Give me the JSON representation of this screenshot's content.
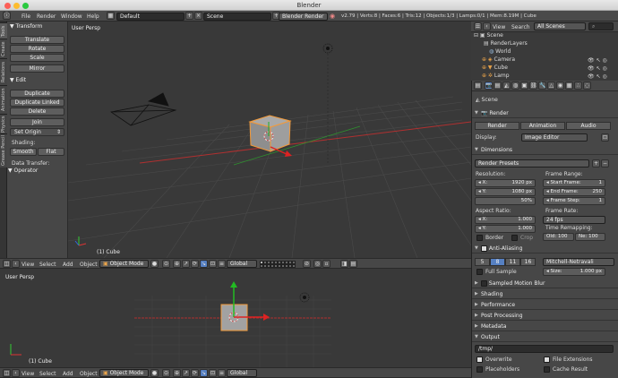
{
  "window": {
    "title": "Blender"
  },
  "info_bar": {
    "menus": [
      "File",
      "Render",
      "Window",
      "Help"
    ],
    "layout": "Default",
    "scene": "Scene",
    "engine": "Blender Render",
    "stats": "v2.79 | Verts:8 | Faces:6 | Tris:12 | Objects:1/3 | Lamps:0/1 | Mem:8.19M | Cube"
  },
  "left_tabs": [
    "Tools",
    "Create",
    "Relations",
    "Animation",
    "Physics",
    "Grease Pencil"
  ],
  "tool_shelf": {
    "transform_title": "Transform",
    "transform_buttons": [
      "Translate",
      "Rotate",
      "Scale",
      "Mirror"
    ],
    "edit_title": "Edit",
    "edit_buttons": [
      "Duplicate",
      "Duplicate Linked",
      "Delete",
      "Join"
    ],
    "set_origin": "Set Origin",
    "shading_label": "Shading:",
    "smooth": "Smooth",
    "flat": "Flat",
    "data_transfer": "Data Transfer:",
    "operator_title": "Operator"
  },
  "viewport_top": {
    "label": "User Persp",
    "object": "(1) Cube"
  },
  "viewport_bottom": {
    "label": "User Persp",
    "object": "(1) Cube"
  },
  "view3d_header": {
    "menus": [
      "View",
      "Select",
      "Add",
      "Object"
    ],
    "mode": "Object Mode",
    "orientation": "Global"
  },
  "outliner": {
    "menus": [
      "View",
      "Search"
    ],
    "filter": "All Scenes",
    "items": [
      "Scene",
      "RenderLayers",
      "World",
      "Camera",
      "Cube",
      "Lamp"
    ]
  },
  "properties": {
    "scene_name": "Scene",
    "render_title": "Render",
    "render_buttons": [
      "Render",
      "Animation",
      "Audio"
    ],
    "display_label": "Display:",
    "display_value": "Image Editor",
    "dimensions_title": "Dimensions",
    "render_presets": "Render Presets",
    "resolution_label": "Resolution:",
    "res_x_label": "X:",
    "res_x": "1920 px",
    "res_y_label": "Y:",
    "res_y": "1080 px",
    "res_pct": "50%",
    "frame_range_label": "Frame Range:",
    "start_label": "Start Frame:",
    "start": "1",
    "end_label": "End Frame:",
    "end": "250",
    "step_label": "Frame Step:",
    "step": "1",
    "aspect_label": "Aspect Ratio:",
    "asp_x_label": "X:",
    "asp_x": "1.000",
    "asp_y_label": "Y:",
    "asp_y": "1.000",
    "frame_rate_label": "Frame Rate:",
    "fps": "24 fps",
    "time_remap_label": "Time Remapping:",
    "old": "Old: 100",
    "new": "Ne: 100",
    "border": "Border",
    "crop": "Crop",
    "aa_title": "Anti-Aliasing",
    "aa_samples": [
      "5",
      "8",
      "11",
      "16"
    ],
    "aa_filter": "Mitchell-Netravali",
    "full_sample": "Full Sample",
    "size_label": "Size:",
    "size": "1.000 px",
    "motion_blur": "Sampled Motion Blur",
    "collapsed_sections": [
      "Shading",
      "Performance",
      "Post Processing",
      "Metadata"
    ],
    "output_title": "Output",
    "output_path": "/tmp/",
    "overwrite": "Overwrite",
    "file_ext": "File Extensions",
    "placeholders": "Placeholders",
    "cache_result": "Cache Result"
  }
}
